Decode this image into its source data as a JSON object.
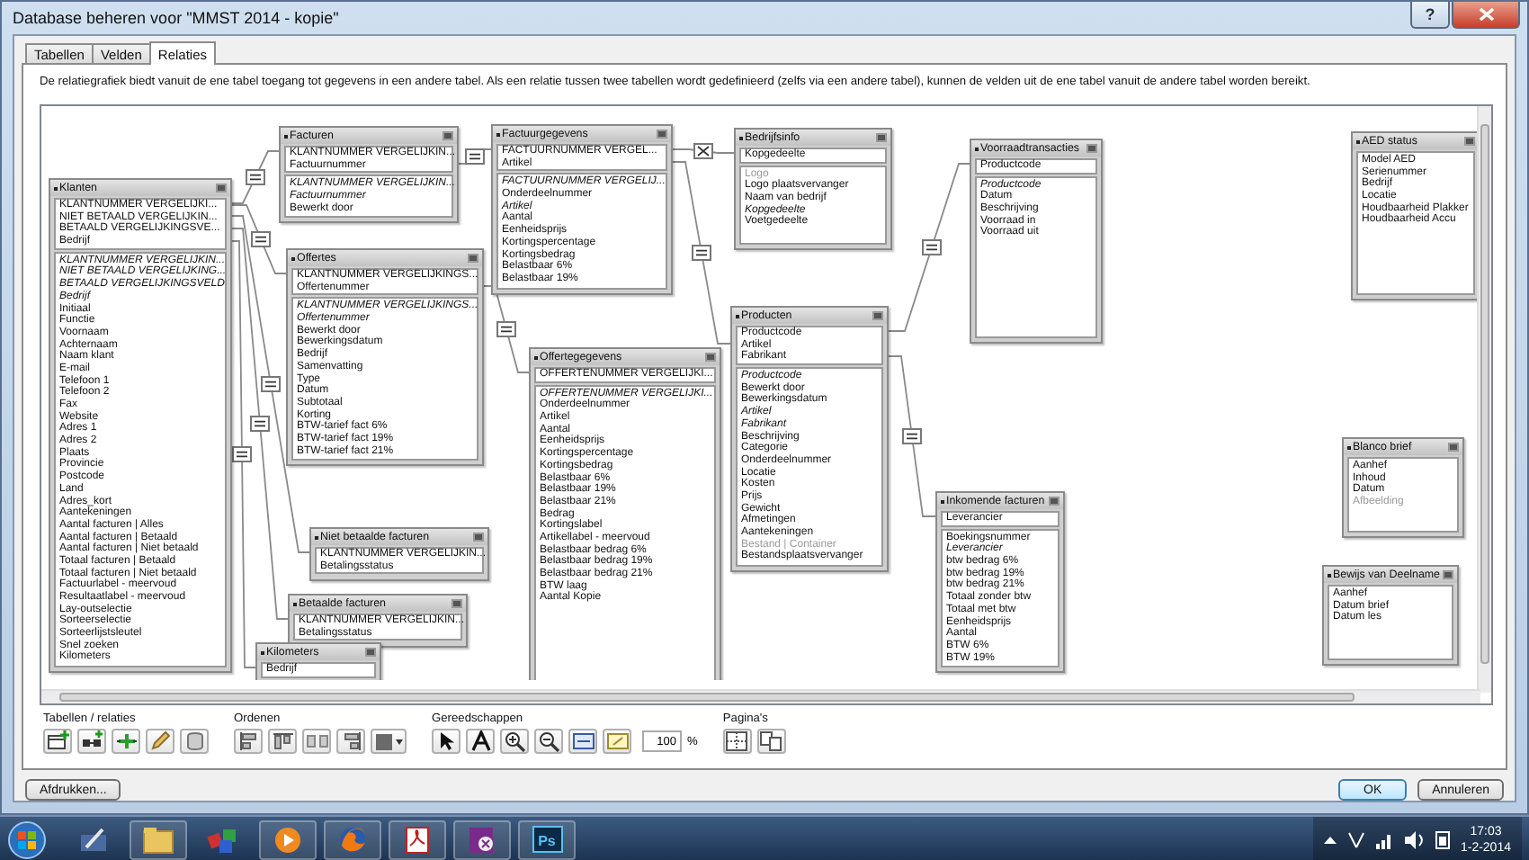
{
  "window": {
    "title": "Database beheren voor \"MMST 2014 - kopie\"",
    "help": "?"
  },
  "tabs": [
    {
      "label": "Tabellen",
      "selected": false
    },
    {
      "label": "Velden",
      "selected": false
    },
    {
      "label": "Relaties",
      "selected": true
    }
  ],
  "description": "De relatiegrafiek biedt vanuit de ene tabel toegang tot gegevens in een andere tabel. Als een relatie tussen twee tabellen wordt gedefinieerd (zelfs via een andere tabel), kunnen de velden uit de ene tabel vanuit de andere tabel worden bereikt.",
  "tables": [
    {
      "name": "Klanten",
      "keys": [
        "KLANTNUMMER VERGELIJKI...",
        "NIET BETAALD VERGELIJKIN...",
        "BETAALD VERGELIJKINGSVE...",
        "Bedrijf"
      ],
      "fields": [
        {
          "label": "KLANTNUMMER VERGELIJKIN...",
          "kind": "key"
        },
        {
          "label": "NIET BETAALD VERGELIJKING...",
          "kind": "key"
        },
        {
          "label": "BETAALD VERGELIJKINGSVELD",
          "kind": "key"
        },
        {
          "label": "Bedrijf",
          "kind": "key"
        },
        {
          "label": "Initiaal",
          "kind": "field"
        },
        {
          "label": "Functie",
          "kind": "field"
        },
        {
          "label": "Voornaam",
          "kind": "field"
        },
        {
          "label": "Achternaam",
          "kind": "field"
        },
        {
          "label": "Naam klant",
          "kind": "field"
        },
        {
          "label": "E-mail",
          "kind": "field"
        },
        {
          "label": "Telefoon 1",
          "kind": "field"
        },
        {
          "label": "Telefoon 2",
          "kind": "field"
        },
        {
          "label": "Fax",
          "kind": "field"
        },
        {
          "label": "Website",
          "kind": "field"
        },
        {
          "label": "Adres 1",
          "kind": "field"
        },
        {
          "label": "Adres 2",
          "kind": "field"
        },
        {
          "label": "Plaats",
          "kind": "field"
        },
        {
          "label": "Provincie",
          "kind": "field"
        },
        {
          "label": "Postcode",
          "kind": "field"
        },
        {
          "label": "Land",
          "kind": "field"
        },
        {
          "label": "Adres_kort",
          "kind": "field"
        },
        {
          "label": "Aantekeningen",
          "kind": "field"
        },
        {
          "label": "Aantal facturen | Alles",
          "kind": "field"
        },
        {
          "label": "Aantal facturen | Betaald",
          "kind": "field"
        },
        {
          "label": "Aantal facturen | Niet betaald",
          "kind": "field"
        },
        {
          "label": "Totaal facturen | Betaald",
          "kind": "field"
        },
        {
          "label": "Totaal facturen | Niet betaald",
          "kind": "field"
        },
        {
          "label": "Factuurlabel - meervoud",
          "kind": "field"
        },
        {
          "label": "Resultaatlabel - meervoud",
          "kind": "field"
        },
        {
          "label": "Lay-outselectie",
          "kind": "field"
        },
        {
          "label": "Sorteerselectie",
          "kind": "field"
        },
        {
          "label": "Sorteerlijstsleutel",
          "kind": "field"
        },
        {
          "label": "Snel zoeken",
          "kind": "field"
        },
        {
          "label": "Kilometers",
          "kind": "field"
        }
      ]
    },
    {
      "name": "Facturen",
      "keys": [
        "KLANTNUMMER VERGELIJKIN...",
        "Factuurnummer"
      ],
      "fields": [
        {
          "label": "KLANTNUMMER VERGELIJKIN...",
          "kind": "key"
        },
        {
          "label": "Factuurnummer",
          "kind": "key"
        },
        {
          "label": "Bewerkt door",
          "kind": "field"
        }
      ]
    },
    {
      "name": "Offertes",
      "keys": [
        "KLANTNUMMER VERGELIJKINGS...",
        "Offertenummer"
      ],
      "fields": [
        {
          "label": "KLANTNUMMER VERGELIJKINGS...",
          "kind": "key"
        },
        {
          "label": "Offertenummer",
          "kind": "key"
        },
        {
          "label": "Bewerkt door",
          "kind": "field"
        },
        {
          "label": "Bewerkingsdatum",
          "kind": "field"
        },
        {
          "label": "Bedrijf",
          "kind": "field"
        },
        {
          "label": "Samenvatting",
          "kind": "field"
        },
        {
          "label": "Type",
          "kind": "field"
        },
        {
          "label": "Datum",
          "kind": "field"
        },
        {
          "label": "Subtotaal",
          "kind": "field"
        },
        {
          "label": "Korting",
          "kind": "field"
        },
        {
          "label": "BTW-tarief fact 6%",
          "kind": "field"
        },
        {
          "label": "BTW-tarief fact 19%",
          "kind": "field"
        },
        {
          "label": "BTW-tarief fact 21%",
          "kind": "field"
        }
      ]
    },
    {
      "name": "Factuurgegevens",
      "keys": [
        "FACTUURNUMMER VERGEL...",
        "Artikel"
      ],
      "fields": [
        {
          "label": "FACTUURNUMMER VERGELIJ...",
          "kind": "key"
        },
        {
          "label": "Onderdeelnummer",
          "kind": "field"
        },
        {
          "label": "Artikel",
          "kind": "key"
        },
        {
          "label": "Aantal",
          "kind": "field"
        },
        {
          "label": "Eenheidsprijs",
          "kind": "field"
        },
        {
          "label": "Kortingspercentage",
          "kind": "field"
        },
        {
          "label": "Kortingsbedrag",
          "kind": "field"
        },
        {
          "label": "Belastbaar 6%",
          "kind": "field"
        },
        {
          "label": "Belastbaar 19%",
          "kind": "field"
        }
      ]
    },
    {
      "name": "Bedrijfsinfo",
      "keys": [
        "Kopgedeelte"
      ],
      "fields": [
        {
          "label": "Logo",
          "kind": "unavailable"
        },
        {
          "label": "Logo plaatsvervanger",
          "kind": "field"
        },
        {
          "label": "Naam van bedrijf",
          "kind": "field"
        },
        {
          "label": "Kopgedeelte",
          "kind": "key"
        },
        {
          "label": "Voetgedeelte",
          "kind": "field"
        }
      ]
    },
    {
      "name": "Offertegegevens",
      "keys": [
        "OFFERTENUMMER VERGELIJKI..."
      ],
      "fields": [
        {
          "label": "OFFERTENUMMER VERGELIJKI...",
          "kind": "key"
        },
        {
          "label": "Onderdeelnummer",
          "kind": "field"
        },
        {
          "label": "Artikel",
          "kind": "field"
        },
        {
          "label": "Aantal",
          "kind": "field"
        },
        {
          "label": "Eenheidsprijs",
          "kind": "field"
        },
        {
          "label": "Kortingspercentage",
          "kind": "field"
        },
        {
          "label": "Kortingsbedrag",
          "kind": "field"
        },
        {
          "label": "Belastbaar 6%",
          "kind": "field"
        },
        {
          "label": "Belastbaar 19%",
          "kind": "field"
        },
        {
          "label": "Belastbaar 21%",
          "kind": "field"
        },
        {
          "label": "Bedrag",
          "kind": "field"
        },
        {
          "label": "Kortingslabel",
          "kind": "field"
        },
        {
          "label": "Artikellabel - meervoud",
          "kind": "field"
        },
        {
          "label": "Belastbaar bedrag 6%",
          "kind": "field"
        },
        {
          "label": "Belastbaar bedrag 19%",
          "kind": "field"
        },
        {
          "label": "Belastbaar bedrag 21%",
          "kind": "field"
        },
        {
          "label": "BTW laag",
          "kind": "field"
        },
        {
          "label": "Aantal Kopie",
          "kind": "field"
        }
      ]
    },
    {
      "name": "Producten",
      "keys": [
        "Productcode",
        "Artikel",
        "Fabrikant"
      ],
      "fields": [
        {
          "label": "Productcode",
          "kind": "key"
        },
        {
          "label": "Bewerkt door",
          "kind": "field"
        },
        {
          "label": "Bewerkingsdatum",
          "kind": "field"
        },
        {
          "label": "Artikel",
          "kind": "key"
        },
        {
          "label": "Fabrikant",
          "kind": "key"
        },
        {
          "label": "Beschrijving",
          "kind": "field"
        },
        {
          "label": "Categorie",
          "kind": "field"
        },
        {
          "label": "Onderdeelnummer",
          "kind": "field"
        },
        {
          "label": "Locatie",
          "kind": "field"
        },
        {
          "label": "Kosten",
          "kind": "field"
        },
        {
          "label": "Prijs",
          "kind": "field"
        },
        {
          "label": "Gewicht",
          "kind": "field"
        },
        {
          "label": "Afmetingen",
          "kind": "field"
        },
        {
          "label": "Aantekeningen",
          "kind": "field"
        },
        {
          "label": "Bestand | Container",
          "kind": "unavailable"
        },
        {
          "label": "Bestandsplaatsvervanger",
          "kind": "field"
        }
      ]
    },
    {
      "name": "Voorraadtransacties",
      "keys": [
        "Productcode"
      ],
      "fields": [
        {
          "label": "Productcode",
          "kind": "key"
        },
        {
          "label": "Datum",
          "kind": "field"
        },
        {
          "label": "Beschrijving",
          "kind": "field"
        },
        {
          "label": "Voorraad in",
          "kind": "field"
        },
        {
          "label": "Voorraad uit",
          "kind": "field"
        }
      ]
    },
    {
      "name": "Inkomende facturen",
      "keys": [
        "Leverancier"
      ],
      "fields": [
        {
          "label": "Boekingsnummer",
          "kind": "field"
        },
        {
          "label": "Leverancier",
          "kind": "key"
        },
        {
          "label": "btw bedrag 6%",
          "kind": "field"
        },
        {
          "label": "btw bedrag 19%",
          "kind": "field"
        },
        {
          "label": "btw bedrag 21%",
          "kind": "field"
        },
        {
          "label": "Totaal zonder btw",
          "kind": "field"
        },
        {
          "label": "Totaal met btw",
          "kind": "field"
        },
        {
          "label": "Eenheidsprijs",
          "kind": "field"
        },
        {
          "label": "Aantal",
          "kind": "field"
        },
        {
          "label": "BTW 6%",
          "kind": "field"
        },
        {
          "label": "BTW 19%",
          "kind": "field"
        }
      ]
    },
    {
      "name": "AED status",
      "fields": [
        {
          "label": "Model AED",
          "kind": "field"
        },
        {
          "label": "Serienummer",
          "kind": "field"
        },
        {
          "label": "Bedrijf",
          "kind": "field"
        },
        {
          "label": "Locatie",
          "kind": "field"
        },
        {
          "label": "Houdbaarheid Plakker",
          "kind": "field"
        },
        {
          "label": "Houdbaarheid Accu",
          "kind": "field"
        }
      ]
    },
    {
      "name": "Blanco brief",
      "fields": [
        {
          "label": "Aanhef",
          "kind": "field"
        },
        {
          "label": "Inhoud",
          "kind": "field"
        },
        {
          "label": "Datum",
          "kind": "field"
        },
        {
          "label": "Afbeelding",
          "kind": "unavailable"
        }
      ]
    },
    {
      "name": "Bewijs van Deelname",
      "fields": [
        {
          "label": "Aanhef",
          "kind": "field"
        },
        {
          "label": "Datum brief",
          "kind": "field"
        },
        {
          "label": "Datum les",
          "kind": "field"
        }
      ]
    },
    {
      "name": "Niet betaalde facturen",
      "keys": [
        "KLANTNUMMER VERGELIJKIN...",
        "Betalingsstatus"
      ]
    },
    {
      "name": "Betaalde facturen",
      "keys": [
        "KLANTNUMMER VERGELIJKIN...",
        "Betalingsstatus"
      ]
    },
    {
      "name": "Kilometers",
      "keys": [
        "Bedrijf"
      ]
    }
  ],
  "relationships": [
    {
      "kind": "equal"
    },
    {
      "kind": "equal"
    },
    {
      "kind": "equal"
    },
    {
      "kind": "equal"
    },
    {
      "kind": "cross"
    },
    {
      "kind": "equal"
    },
    {
      "kind": "equal"
    },
    {
      "kind": "equal"
    },
    {
      "kind": "equal"
    },
    {
      "kind": "equal"
    },
    {
      "kind": "equal"
    }
  ],
  "toolbar": {
    "groups": [
      "Tabellen / relaties",
      "Ordenen",
      "Gereedschappen",
      "Pagina's"
    ],
    "zoom": "100",
    "zoom_unit": "%"
  },
  "buttons": {
    "print": "Afdrukken...",
    "ok": "OK",
    "cancel": "Annuleren"
  },
  "taskbar": {
    "app_label": "Ps",
    "time": "17:03",
    "date": "1-2-2014"
  }
}
